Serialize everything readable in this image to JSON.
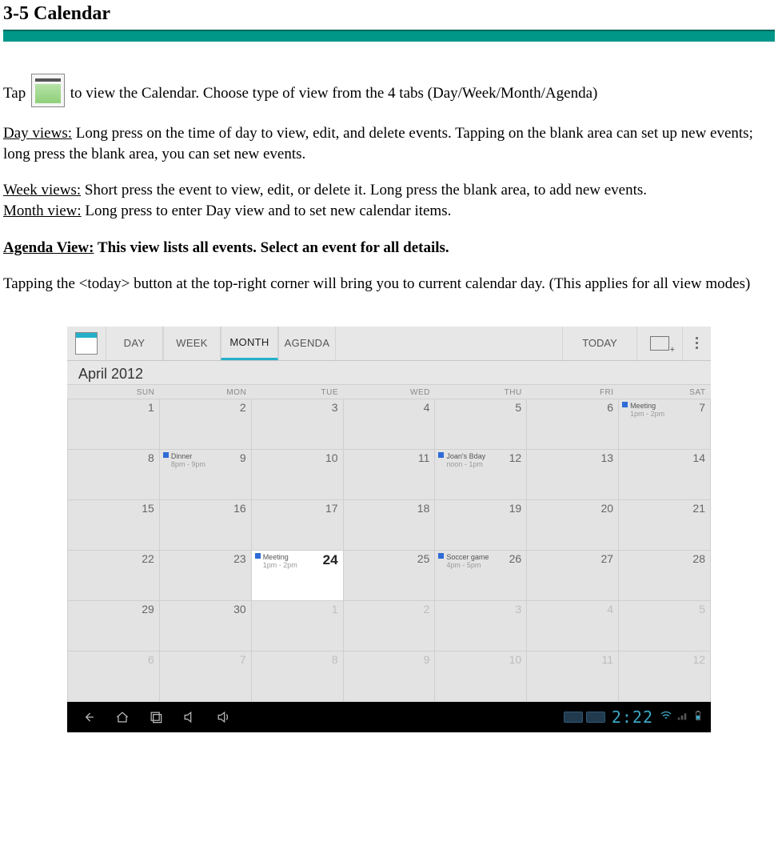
{
  "doc": {
    "title": "3-5 Calendar",
    "p1a": "Tap ",
    "p1b": " to view the Calendar.    Choose type of view from the 4 tabs (Day/Week/Month/Agenda)",
    "dayLabel": "Day views:",
    "dayText": " Long press on the time of day to view, edit, and delete events.    Tapping on the blank area can set up new events; long press the blank area, you can set new events.",
    "weekLabel": "Week views:",
    "weekText": " Short press the event to view, edit, or delete it.    Long press the blank area, to add new events.",
    "monthLabel": "Month view:",
    "monthText": " Long press to enter Day view and to set new calendar items.",
    "agendaLabel": "Agenda View:",
    "agendaText": " This view lists all events. Select an event for all details.",
    "p5": "Tapping the <today> button at the top-right corner will bring you to current calendar day.    (This applies for all view modes)"
  },
  "calendar": {
    "tabs": {
      "day": "DAY",
      "week": "WEEK",
      "month": "MONTH",
      "agenda": "AGENDA"
    },
    "today_btn": "TODAY",
    "month_label": "April 2012",
    "dow": [
      "SUN",
      "MON",
      "TUE",
      "WED",
      "THU",
      "FRI",
      "SAT"
    ],
    "grid": [
      [
        {
          "n": "1"
        },
        {
          "n": "2"
        },
        {
          "n": "3"
        },
        {
          "n": "4"
        },
        {
          "n": "5"
        },
        {
          "n": "6"
        },
        {
          "n": "7",
          "ev": {
            "title": "Meeting",
            "time": "1pm - 2pm"
          }
        }
      ],
      [
        {
          "n": "8"
        },
        {
          "n": "9",
          "ev": {
            "title": "Dinner",
            "time": "8pm - 9pm"
          }
        },
        {
          "n": "10"
        },
        {
          "n": "11"
        },
        {
          "n": "12",
          "ev": {
            "title": "Joan's Bday",
            "time": "noon - 1pm"
          }
        },
        {
          "n": "13"
        },
        {
          "n": "14"
        }
      ],
      [
        {
          "n": "15"
        },
        {
          "n": "16"
        },
        {
          "n": "17"
        },
        {
          "n": "18"
        },
        {
          "n": "19"
        },
        {
          "n": "20"
        },
        {
          "n": "21"
        }
      ],
      [
        {
          "n": "22"
        },
        {
          "n": "23"
        },
        {
          "n": "24",
          "today": true,
          "ev": {
            "title": "Meeting",
            "time": "1pm - 2pm"
          }
        },
        {
          "n": "25"
        },
        {
          "n": "26",
          "ev": {
            "title": "Soccer game",
            "time": "4pm - 5pm"
          }
        },
        {
          "n": "27"
        },
        {
          "n": "28"
        }
      ],
      [
        {
          "n": "29"
        },
        {
          "n": "30"
        },
        {
          "n": "1",
          "dim": true
        },
        {
          "n": "2",
          "dim": true
        },
        {
          "n": "3",
          "dim": true
        },
        {
          "n": "4",
          "dim": true
        },
        {
          "n": "5",
          "dim": true
        }
      ],
      [
        {
          "n": "6",
          "dim": true
        },
        {
          "n": "7",
          "dim": true
        },
        {
          "n": "8",
          "dim": true
        },
        {
          "n": "9",
          "dim": true
        },
        {
          "n": "10",
          "dim": true
        },
        {
          "n": "11",
          "dim": true
        },
        {
          "n": "12",
          "dim": true
        }
      ]
    ]
  },
  "sysbar": {
    "time": "2:22"
  }
}
